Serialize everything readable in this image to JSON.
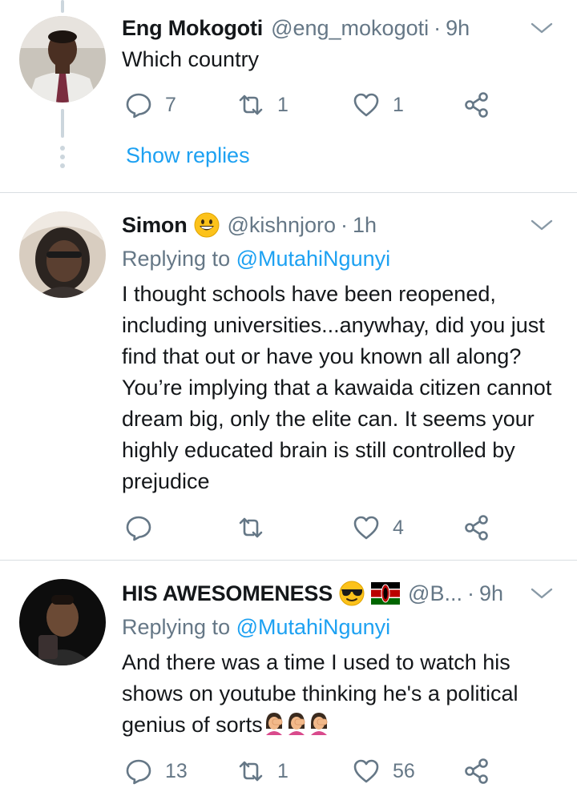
{
  "tweets": [
    {
      "author": {
        "name": "Eng Mokogoti",
        "handle": "@eng_mokogoti",
        "avatar": "avatar"
      },
      "time": "9h",
      "text": "Which country",
      "replying_to": null,
      "stats": {
        "replies": "7",
        "retweets": "1",
        "likes": "1"
      },
      "show_replies_label": "Show replies"
    },
    {
      "author": {
        "name": "Simon",
        "handle": "@kishnjoro",
        "name_emoji": "grinning-face-emoji"
      },
      "time": "1h",
      "replying_to": {
        "prefix": "Replying to",
        "mention": "@MutahiNgunyi"
      },
      "text": "I thought schools have been reopened, including universities...anywhay, did you just find that out or have you known all along? You’re implying that a kawaida citizen cannot dream big, only the elite can. It seems your highly educated brain is still controlled by prejudice",
      "stats": {
        "replies": "",
        "retweets": "",
        "likes": "4"
      }
    },
    {
      "author": {
        "name": "HIS AWESOMENESS",
        "handle": "@B...",
        "name_emoji": [
          "smiling-face-with-sunglasses-emoji",
          "kenya-flag-emoji"
        ]
      },
      "time": "9h",
      "replying_to": {
        "prefix": "Replying to",
        "mention": "@MutahiNgunyi"
      },
      "text": "And there was a time I used to watch his shows on youtube thinking he's a political genius of sorts",
      "text_emoji": [
        "woman-facepalming-emoji",
        "woman-facepalming-emoji",
        "woman-facepalming-emoji"
      ],
      "stats": {
        "replies": "13",
        "retweets": "1",
        "likes": "56"
      }
    }
  ],
  "separator": "·",
  "icons": {
    "reply": "reply-icon",
    "retweet": "retweet-icon",
    "like": "heart-icon",
    "share": "share-icon",
    "menu": "chevron-down-icon"
  },
  "colors": {
    "link": "#1da1f2",
    "secondary_text": "#657786",
    "divider": "#d9dee2",
    "thread_line": "#ccd6dd"
  }
}
